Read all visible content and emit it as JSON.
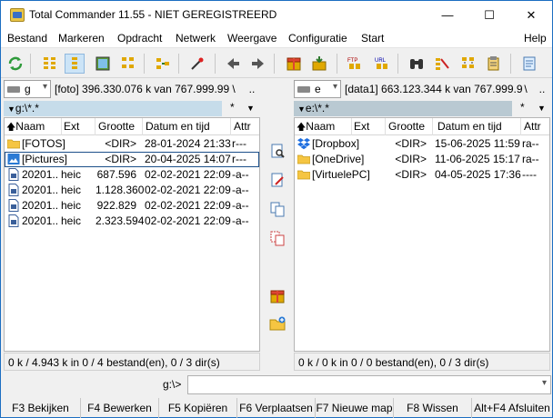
{
  "window": {
    "title": "Total Commander 11.55 - NIET GEREGISTREERD",
    "minimize": "—",
    "maximize": "☐",
    "close": "✕"
  },
  "menu": [
    "Bestand",
    "Markeren",
    "Opdracht",
    "Netwerk",
    "Weergave",
    "Configuratie",
    "Start",
    "Help"
  ],
  "left": {
    "drive": "g",
    "free_space": "[foto]  396.330.076 k van 767.999.99",
    "root_btn": "\\",
    "up_btn": "..",
    "path": "g:\\*.*",
    "star": "*",
    "dropdown": "▼",
    "columns": [
      "Naam",
      "Ext",
      "Grootte",
      "Datum en tijd",
      "Attr"
    ],
    "rows": [
      {
        "name": "[FOTOS]",
        "ext": "",
        "size": "<DIR>",
        "date": "28-01-2024 21:33",
        "attr": "r---",
        "icon": "folder-icon"
      },
      {
        "name": "[Pictures]",
        "ext": "",
        "size": "<DIR>",
        "date": "20-04-2025 14:07",
        "attr": "r---",
        "icon": "pictures-folder-icon"
      },
      {
        "name": "20201..",
        "ext": "heic",
        "size": "687.596",
        "date": "02-02-2021 22:09",
        "attr": "-a--",
        "icon": "file-icon"
      },
      {
        "name": "20201..",
        "ext": "heic",
        "size": "1.128.360",
        "date": "02-02-2021 22:09",
        "attr": "-a--",
        "icon": "file-icon"
      },
      {
        "name": "20201..",
        "ext": "heic",
        "size": "922.829",
        "date": "02-02-2021 22:09",
        "attr": "-a--",
        "icon": "file-icon"
      },
      {
        "name": "20201..",
        "ext": "heic",
        "size": "2.323.594",
        "date": "02-02-2021 22:09",
        "attr": "-a--",
        "icon": "file-icon"
      }
    ],
    "status": "0 k / 4.943 k in 0 / 4 bestand(en), 0 / 3 dir(s)"
  },
  "right": {
    "drive": "e",
    "free_space": "[data1]  663.123.344 k van 767.999.9",
    "root_btn": "\\",
    "up_btn": "..",
    "path": "e:\\*.*",
    "star": "*",
    "dropdown": "▼",
    "columns": [
      "Naam",
      "Ext",
      "Grootte",
      "Datum en tijd",
      "Attr"
    ],
    "rows": [
      {
        "name": "[Dropbox]",
        "ext": "",
        "size": "<DIR>",
        "date": "15-06-2025 11:59",
        "attr": "ra--",
        "icon": "dropbox-icon"
      },
      {
        "name": "[OneDrive]",
        "ext": "",
        "size": "<DIR>",
        "date": "11-06-2025 15:17",
        "attr": "ra--",
        "icon": "folder-icon"
      },
      {
        "name": "[VirtuelePC]",
        "ext": "",
        "size": "<DIR>",
        "date": "04-05-2025 17:36",
        "attr": "----",
        "icon": "folder-icon"
      }
    ],
    "status": "0 k / 0 k in 0 / 0 bestand(en), 0 / 3 dir(s)"
  },
  "cmdline": {
    "label": "g:\\>",
    "value": ""
  },
  "fkeys": [
    "F3 Bekijken",
    "F4 Bewerken",
    "F5 Kopiëren",
    "F6 Verplaatsen",
    "F7 Nieuwe map",
    "F8 Wissen",
    "Alt+F4 Afsluiten"
  ],
  "colors": {
    "path_active": "#c6dcea",
    "path_inactive": "#b9c9d2",
    "folder": "#f5c542",
    "accent": "#1c6ec1"
  }
}
